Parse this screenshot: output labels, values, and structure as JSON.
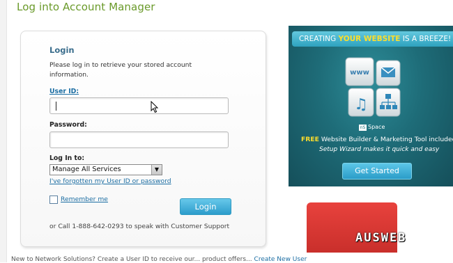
{
  "page": {
    "title": "Log into Account Manager"
  },
  "login_panel": {
    "heading": "Login",
    "intro": "Please log in to retrieve your stored account information.",
    "user_id_label": "User ID:",
    "user_id_value": "",
    "password_label": "Password:",
    "password_value": "",
    "log_in_to_label": "Log In to:",
    "log_in_to_selected": "Manage All Services",
    "forgot_link": "I've forgotten my User ID or password",
    "remember_me_label": "Remember me",
    "remember_me_checked": false,
    "login_button": "Login",
    "support_text": "or Call 1-888-642-0293 to speak with Customer Support"
  },
  "bottom_text": {
    "prefix": "New to Network Solutions? Create a User ID to receive our... product offers...",
    "link": "Create New User"
  },
  "ad": {
    "headline_pre": "CREATING ",
    "headline_highlight": "YOUR WEBSITE",
    "headline_post": " IS A BREEZE!",
    "tiles": [
      "www",
      "email-icon",
      "music-icon",
      "sitemap-icon"
    ],
    "logo_text": "Space",
    "logo_mark": "nS",
    "line1_highlight": "FREE",
    "line1_rest": " Website Builder & Marketing Tool included",
    "line2": "Setup Wizard makes it quick and easy",
    "button": "Get Started",
    "colors": {
      "headline_bg": "#3fb3cf",
      "highlight": "#ffde2a",
      "background": "#1e6c78"
    }
  },
  "watermark": {
    "text": "AUSWEB",
    "color": "#d93733"
  },
  "colors": {
    "title": "#6a9a2a",
    "link": "#1c6ea3",
    "heading": "#3a6d8c",
    "button": "#2c9ccb"
  }
}
